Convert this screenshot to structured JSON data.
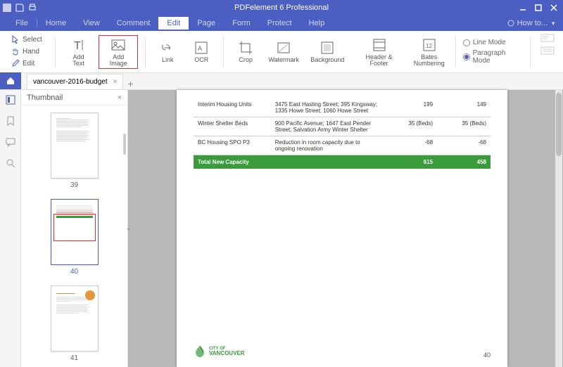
{
  "titlebar": {
    "app_title": "PDFelement 6 Professional"
  },
  "menus": {
    "file": "File",
    "home": "Home",
    "view": "View",
    "comment": "Comment",
    "edit": "Edit",
    "page": "Page",
    "form": "Form",
    "protect": "Protect",
    "help": "Help",
    "howto": "How to..."
  },
  "ribbon": {
    "select": "Select",
    "hand": "Hand",
    "edit": "Edit",
    "add_text": "Add Text",
    "add_image": "Add Image",
    "link": "Link",
    "ocr": "OCR",
    "crop": "Crop",
    "watermark": "Watermark",
    "background": "Background",
    "header_footer": "Header & Footer",
    "bates": "Bates\nNumbering",
    "line_mode": "Line Mode",
    "paragraph_mode": "Paragraph Mode"
  },
  "tab": {
    "filename": "vancouver-2016-budget"
  },
  "thumb": {
    "title": "Thumbnail",
    "p39": "39",
    "p40": "40",
    "p41": "41"
  },
  "doc": {
    "rows": [
      {
        "label": "Interim Housing Units",
        "desc": "3475 East Hasting Street; 395 Kingsway; 1335 Howe Street; 1060 Howe Street",
        "c1": "199",
        "c2": "149"
      },
      {
        "label": "Winter Shelter Beds",
        "desc": "900 Pacific Avenue; 1647 East Pender Street; Salvation Army Winter Shelter",
        "c1": "35 (Beds)",
        "c2": "35 (Beds)"
      },
      {
        "label": "BC Housing SPO P3",
        "desc": "Reduction in room capacity due to ongoing renovation",
        "c1": "-68",
        "c2": "-68"
      }
    ],
    "total_label": "Total New Capacity",
    "total_c1": "615",
    "total_c2": "458",
    "logo_top": "CITY OF",
    "logo_bottom": "VANCOUVER",
    "page_number": "40"
  }
}
